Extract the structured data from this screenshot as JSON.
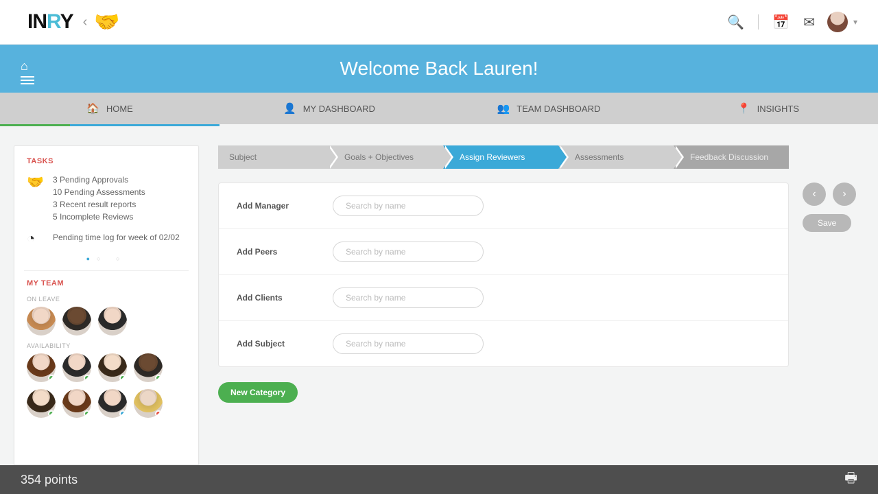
{
  "top": {
    "logo_in": "IN",
    "logo_r": "R",
    "logo_y": "Y"
  },
  "banner": {
    "title": "Welcome Back Lauren!"
  },
  "nav": {
    "home": "HOME",
    "my_dash": "MY DASHBOARD",
    "team_dash": "TEAM DASHBOARD",
    "insights": "INSIGHTS"
  },
  "sidebar": {
    "tasks_title": "TASKS",
    "tasks": {
      "line1": "3 Pending Approvals",
      "line2": "10 Pending Assessments",
      "line3": "3 Recent result reports",
      "line4": "5 Incomplete Reviews"
    },
    "timelog": "Pending time log for week of 02/02",
    "team_title": "MY TEAM",
    "on_leave": "ON LEAVE",
    "availability": "AVAILABILITY"
  },
  "steps": {
    "s1": "Subject",
    "s2": "Goals + Objectives",
    "s3": "Assign Reviewers",
    "s4": "Assessments",
    "s5": "Feedback Discussion"
  },
  "form": {
    "manager": "Add Manager",
    "peers": "Add Peers",
    "clients": "Add Clients",
    "subject": "Add Subject",
    "placeholder": "Search by name",
    "new_category": "New Category"
  },
  "controls": {
    "save": "Save"
  },
  "footer": {
    "points": "354 points"
  }
}
